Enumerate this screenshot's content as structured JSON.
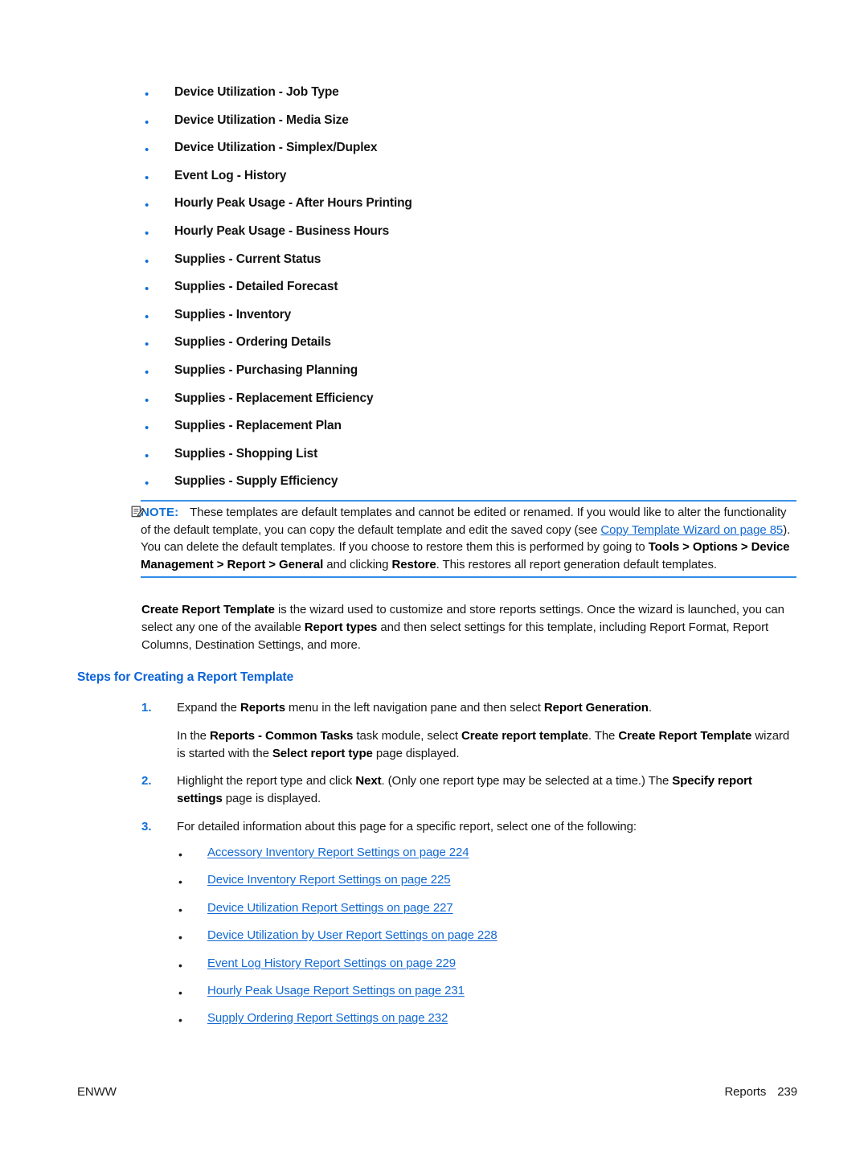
{
  "template_list": {
    "bullet_color": "#0f6fd6",
    "items": [
      "Device Utilization - Job Type",
      "Device Utilization - Media Size",
      "Device Utilization - Simplex/Duplex",
      "Event Log - History",
      "Hourly Peak Usage - After Hours Printing",
      "Hourly Peak Usage - Business Hours",
      "Supplies - Current Status",
      "Supplies - Detailed Forecast",
      "Supplies - Inventory",
      "Supplies - Ordering Details",
      "Supplies - Purchasing Planning",
      "Supplies - Replacement Efficiency",
      "Supplies - Replacement Plan",
      "Supplies - Shopping List",
      "Supplies - Supply Efficiency"
    ]
  },
  "note": {
    "icon": "note-pencil-icon",
    "label": "NOTE:",
    "accent_color": "#0f6fd6",
    "rule_color": "#3b91e8",
    "text_part_1": "These templates are default templates and cannot be edited or renamed. If you would like to alter the functionality of the default template, you can copy the default template and edit the saved copy (see ",
    "link_text": "Copy Template Wizard on page 85",
    "text_part_2": "). You can delete the default templates. If you choose to restore them this is performed by going to ",
    "bold_path": "Tools > Options > Device Management > Report > General",
    "text_part_3": " and clicking ",
    "bold_restore": "Restore",
    "text_part_4": ". This restores all report generation default templates."
  },
  "create_report_paragraph": {
    "bold_lead": "Create Report Template",
    "text_1": " is the wizard used to customize and store reports settings. Once the wizard is launched, you can select any one of the available ",
    "bold_report_types": "Report types",
    "text_2": " and then select settings for this template, including Report Format, Report Columns, Destination Settings, and more."
  },
  "section_heading": "Steps for Creating a Report Template",
  "steps": [
    {
      "number": "1.",
      "text_1": "Expand the ",
      "bold_1": "Reports",
      "text_2": " menu in the left navigation pane and then select ",
      "bold_2": "Report Generation",
      "text_3": ".",
      "continuation": {
        "text_1": "In the ",
        "bold_1": "Reports - Common Tasks",
        "text_2": " task module, select ",
        "bold_2": "Create report template",
        "text_3": ". The ",
        "bold_3": "Create Report Template",
        "text_4": " wizard is started with the ",
        "bold_4": "Select report type",
        "text_5": " page displayed."
      }
    },
    {
      "number": "2.",
      "text_1": "Highlight the report type and click ",
      "bold_1": "Next",
      "text_2": ". (Only one report type may be selected at a time.) The ",
      "bold_2": "Specify report settings",
      "text_3": " page is displayed."
    },
    {
      "number": "3.",
      "text_1": "For detailed information about this page for a specific report, select one of the following:",
      "bold_1": "",
      "text_2": "",
      "bold_2": "",
      "text_3": ""
    }
  ],
  "link_list": {
    "bullet_color": "#1a1a1a",
    "link_color": "#1269d3",
    "items": [
      "Accessory Inventory Report Settings on page 224",
      "Device Inventory Report Settings on page 225",
      "Device Utilization Report Settings on page 227",
      "Device Utilization by User Report Settings on page 228",
      "Event Log History Report Settings on page 229",
      "Hourly Peak Usage Report Settings on page 231",
      "Supply Ordering Report Settings on page 232"
    ]
  },
  "footer": {
    "left": "ENWW",
    "chapter": "Reports",
    "page_number": "239"
  }
}
